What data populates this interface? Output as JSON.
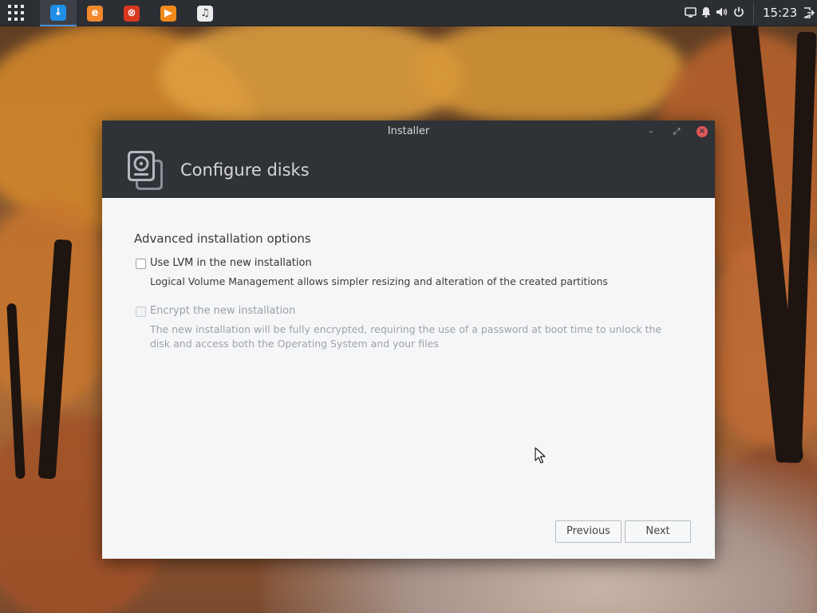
{
  "panel": {
    "clock": "15:23",
    "tasks": [
      {
        "name": "installer-task",
        "color": "#1e8ee6",
        "glyph": "↓",
        "active": true
      },
      {
        "name": "browser-task",
        "color": "#f0882c",
        "glyph": "e",
        "active": false
      },
      {
        "name": "settings-task",
        "color": "#d9381e",
        "glyph": "⊗",
        "active": false
      },
      {
        "name": "media-player-task",
        "color": "#f08a1c",
        "glyph": "▶",
        "active": false
      },
      {
        "name": "music-task",
        "color": "#ececec",
        "glyph": "♫",
        "active": false
      }
    ],
    "tray_icons": [
      "display-icon",
      "bell-icon",
      "volume-icon",
      "power-icon",
      "logout-icon"
    ]
  },
  "window": {
    "title": "Installer",
    "header_title": "Configure disks",
    "section_title": "Advanced installation options",
    "options": [
      {
        "label": "Use LVM in the new installation",
        "description": "Logical Volume Management allows simpler resizing and alteration of the created partitions",
        "checked": false,
        "enabled": true
      },
      {
        "label": "Encrypt the new installation",
        "description": "The new installation will be fully encrypted, requiring the use of a password at boot time to unlock the disk and access both the Operating System and your files",
        "checked": false,
        "enabled": false
      }
    ],
    "buttons": {
      "previous": "Previous",
      "next": "Next"
    }
  },
  "colors": {
    "panel_bg": "#2b2e33",
    "header_bg": "#2f3237",
    "content_bg": "#f5f6f7",
    "close_button": "#e0575a"
  }
}
